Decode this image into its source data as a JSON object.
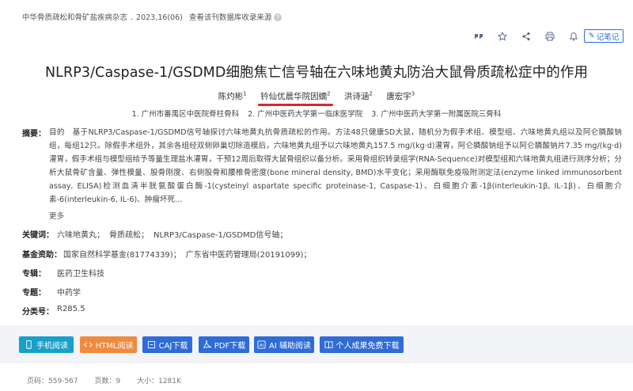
{
  "source": {
    "journal": "中华骨质疏松和骨矿盐疾病杂志",
    "issue": "2023,16(06)",
    "index_link": "查看该刊数据库收录来源"
  },
  "toolbar": {
    "icons": [
      "quote-icon",
      "star-icon",
      "share-icon",
      "print-icon",
      "bell-icon"
    ],
    "note_label": "记笔记"
  },
  "title": "NLRP3/Caspase-1/GSDMD细胞焦亡信号轴在六味地黄丸防治大鼠骨质疏松症中的作用",
  "authors": [
    {
      "name": "陈灼彬",
      "sup": "1"
    },
    {
      "name": "钤仙优晨华院因蠕",
      "sup": "2"
    },
    {
      "name": "洪诗涵",
      "sup": "2"
    },
    {
      "name": "唐宏宇",
      "sup": "3"
    }
  ],
  "affiliations": [
    "1. 广州市番禺区中医院脊柱骨科",
    "2. 广州中医药大学第一临床医学院",
    "3. 广州中医药大学第一附属医院三骨科"
  ],
  "abstract": {
    "label": "摘要：",
    "text": "目的　基于NLRP3/Caspase-1/GSDMD信号轴探讨六味地黄丸抗骨质疏松的作用。方法48只健康SD大鼠，随机分为假手术组、模型组、六味地黄丸组以及阿仑膦酸钠组，每组12只。除假手术组外，其余各组经双侧卵巢切除造模后，六味地黄丸组予以六味地黄丸157.5 mg/(kg·d)灌胃，阿仑膦酸钠组予以阿仑膦酸钠片7.35 mg/(kg·d)灌胃，假手术组与模型组给予等量生理盐水灌胃，干预12周后取得大鼠骨组织以备分析。采用骨组织转录组学(RNA-Sequence)对模型组和六味地黄丸组进行测序分析；分析大鼠骨矿含量、弹性模量、股骨刚度、右侧股骨和腰椎骨密度(bone mineral density, BMD)水平变化；采用酶联免疫吸附测定法(enzyme linked immunosorbent assay, ELISA)检测血清半胱氨酸蛋白酶-1(cysteinyl aspartate specific proteinase-1, Caspase-1)、白细胞介素-1β(interleukin-1β, IL-1β)、白细胞介素-6(interleukin-6, IL-6)、肿瘤坏死...",
    "more": "更多"
  },
  "keywords": {
    "label": "关键词：",
    "items": [
      "六味地黄丸；",
      "骨质疏松；",
      "NLRP3/Caspase-1/GSDMD信号轴；"
    ]
  },
  "funding": {
    "label": "基金资助：",
    "items": [
      "国家自然科学基金(81774339)；",
      "广东省中医药管理局(20191099)；"
    ]
  },
  "series": {
    "label": "专辑：",
    "value": "医药卫生科技"
  },
  "topic": {
    "label": "专题：",
    "value": "中药学"
  },
  "class_no": {
    "label": "分类号：",
    "value": "R285.5"
  },
  "actions": {
    "phone": "手机阅读",
    "html": "HTML阅读",
    "caj": "CAJ下载",
    "pdf": "PDF下载",
    "ai": "AI 辅助阅读",
    "personal": "个人成果免费下载"
  },
  "footer": {
    "pages": "页码：559-567",
    "page_count": "页数：9",
    "size": "大小：1281K"
  }
}
